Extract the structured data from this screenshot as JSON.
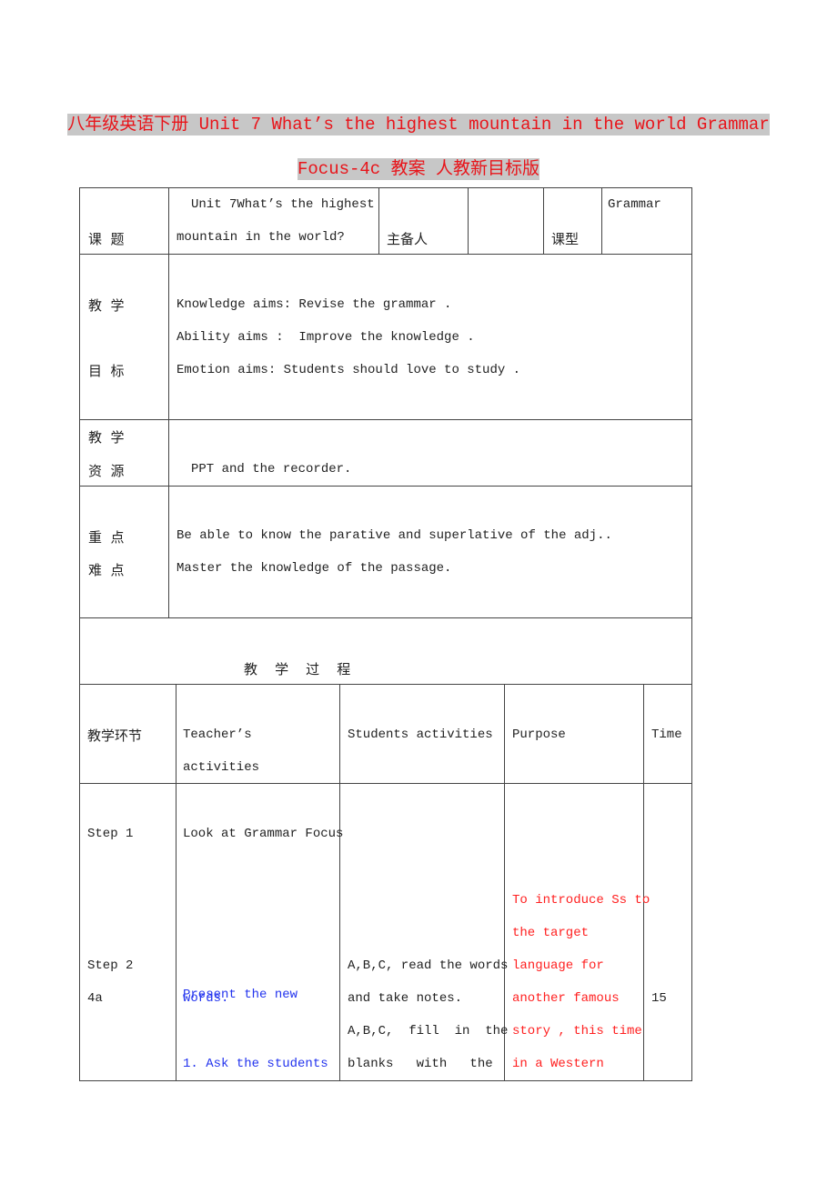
{
  "title": {
    "line1": "八年级英语下册 Unit 7 What’s the highest mountain in the world Grammar",
    "line2": "Focus-4c 教案 人教新目标版"
  },
  "header_row": {
    "label": "课  题",
    "topic_line1": "Unit 7What’s the highest",
    "topic_line2": "mountain in the world?",
    "preparer_label": "主备人",
    "preparer_value": "",
    "type_label": "课型",
    "type_value": "Grammar"
  },
  "objectives": {
    "label_line1": "教  学",
    "label_line2": "目  标",
    "lines": [
      "Knowledge aims: Revise the grammar .",
      "Ability aims :  Improve the knowledge .",
      "Emotion aims: Students should love to study ."
    ]
  },
  "resources": {
    "label_line1": "教  学",
    "label_line2": "资  源",
    "text": "PPT and the recorder."
  },
  "key_points": {
    "label_line1": "重  点",
    "label_line2": "难  点",
    "lines": [
      "Be able to know the parative and superlative of the adj..",
      "Master the knowledge of the passage."
    ]
  },
  "process": {
    "heading": "教    学    过    程",
    "columns": [
      "教学环节",
      "Teacher’s",
      "activities",
      "Students activities",
      "Purpose",
      "Time"
    ],
    "rows": [
      {
        "step": "Step 1",
        "teacher": "Look at Grammar Focus",
        "students": "",
        "purpose": "",
        "time": ""
      },
      {
        "step": "Step 2",
        "substep": "4a",
        "teacher_lines": [
          "Present the new",
          "words.",
          "",
          "1. Ask the students"
        ],
        "students_lines": [
          "A,B,C, read the words",
          "and take notes.",
          "A,B,C,  fill  in  the",
          "blanks   with   the"
        ],
        "purpose_lines": [
          "To introduce Ss to",
          "the target",
          "language for",
          "another famous",
          "story , this time",
          "in a Western"
        ],
        "time": "15"
      }
    ]
  },
  "colors": {
    "title_red": "#e8141a",
    "title_highlight": "#c7c7c7",
    "purpose_red": "#ff2020",
    "teacher_blue": "#2233ee"
  }
}
